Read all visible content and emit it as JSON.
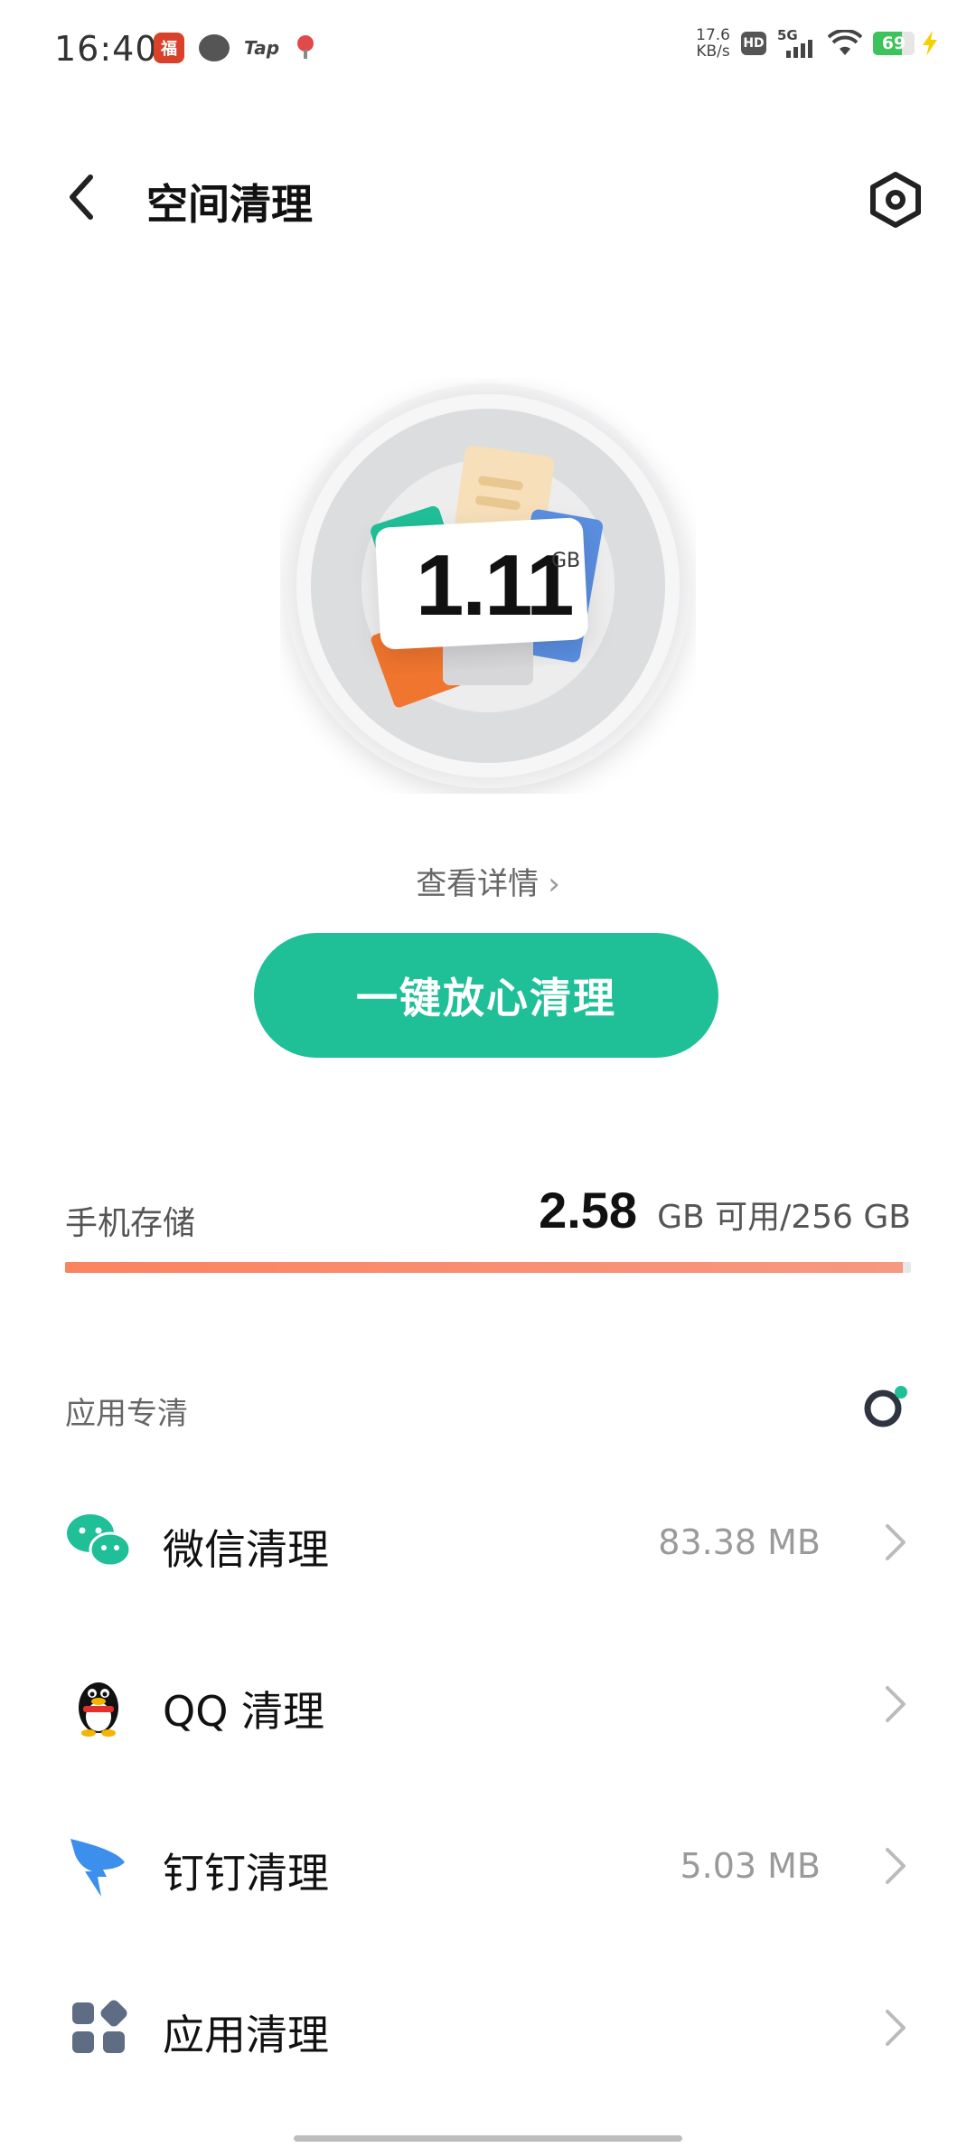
{
  "status_bar": {
    "time": "16:40",
    "notif_app_glyph": "福",
    "notif_tap": "Tap",
    "net_speed_value": "17.6",
    "net_speed_unit": "KB/s",
    "hd": "HD",
    "network": "5G",
    "battery": "69",
    "battery_level": 0.69,
    "battery_color": "#3cc35b"
  },
  "header": {
    "title": "空间清理"
  },
  "hero": {
    "junk_size": "1.11",
    "junk_unit": "GB"
  },
  "details_link": {
    "label": "查看详情",
    "chevron": "›"
  },
  "clean_button": {
    "label": "一键放心清理",
    "color": "#1fbf98"
  },
  "storage": {
    "label": "手机存储",
    "available": "2.58",
    "total_text": "GB 可用/256 GB",
    "used_fraction": 0.9899,
    "bar_color": "#fb8360"
  },
  "app_section": {
    "title": "应用专清",
    "items": [
      {
        "label": "微信清理",
        "size": "83.38 MB",
        "icon": "wechat-icon"
      },
      {
        "label": "QQ 清理",
        "size": "",
        "icon": "qq-icon"
      },
      {
        "label": "钉钉清理",
        "size": "5.03 MB",
        "icon": "dingtalk-icon"
      },
      {
        "label": "应用清理",
        "size": "",
        "icon": "apps-grid-icon"
      }
    ]
  }
}
